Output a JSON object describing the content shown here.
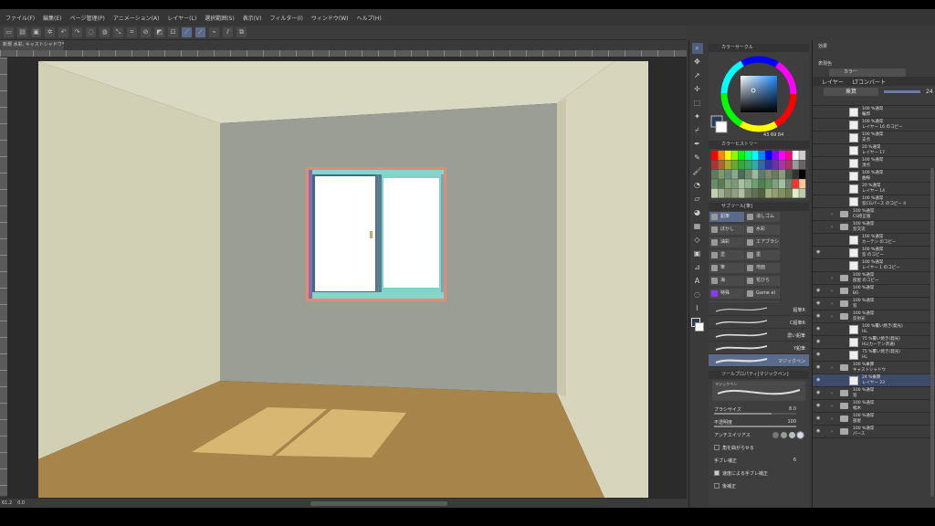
{
  "menu": [
    "ファイル(F)",
    "編集(E)",
    "ページ管理(P)",
    "アニメーション(A)",
    "レイヤー(L)",
    "選択範囲(S)",
    "表示(V)",
    "フィルター(I)",
    "ウィンドウ(W)",
    "ヘルプ(H)"
  ],
  "document_tab": "新規 水彩, キャストシャドウ* ×",
  "status": {
    "zoom": "61.2",
    "angle": "0.0"
  },
  "color_panel": {
    "title": "カラーサークル",
    "values": "43  69  84"
  },
  "swatch_panel": {
    "title": "カラーヒストリー"
  },
  "subtool": {
    "title": "サブツール[筆]",
    "tabs": [
      "鉛筆",
      "消しゴム",
      "ぼかし",
      "水彩",
      "油彩",
      "エアブラシ",
      "塗",
      "墨",
      "筆",
      "地面",
      "海",
      "花びら",
      "特殊",
      "Game el",
      "brushes",
      "ブラシ素材",
      "velvetco",
      "velvetco",
      "Rock&Di"
    ],
    "brushes": [
      {
        "name": "鉛筆R"
      },
      {
        "name": "C鉛筆R"
      },
      {
        "name": "濃い鉛筆"
      },
      {
        "name": "Y鉛筆"
      },
      {
        "name": "マジックペン"
      }
    ]
  },
  "tool_property": {
    "title": "ツールプロパティ[マジックペン]",
    "brush_preview_name": "マジックペン",
    "brush_size_label": "ブラシサイズ",
    "brush_size_value": "8.0",
    "opacity_label": "不透明度",
    "opacity_value": "100",
    "antialias_label": "アンチエイリアス",
    "corner_label": "角を曲がらせる",
    "stabilize_label": "手ブレ補正",
    "stabilize_value": "6",
    "speed_label": "速度による手ブレ補正",
    "post_label": "後補正"
  },
  "layer_panel": {
    "effect_label": "効果",
    "expression_label": "表現色",
    "expression_value": "カラー",
    "tab_layer": "レイヤー",
    "tab_other": "LTコンバート",
    "blend": "乗算",
    "opacity": "24",
    "layers": [
      {
        "mode": "100 %通常",
        "name": "輪郭",
        "type": "layer",
        "eye": false
      },
      {
        "mode": "100 %通常",
        "name": "レイヤー 16 のコピー",
        "type": "layer",
        "eye": false
      },
      {
        "mode": "100 %通常",
        "name": "支点",
        "type": "layer",
        "eye": false
      },
      {
        "mode": "20 %通常",
        "name": "レイヤー 17",
        "type": "layer",
        "eye": false
      },
      {
        "mode": "100 %通常",
        "name": "頂点",
        "type": "layer",
        "eye": false
      },
      {
        "mode": "100 %通常",
        "name": "曲線",
        "type": "layer",
        "eye": false
      },
      {
        "mode": "20 %通常",
        "name": "レイヤー 14",
        "type": "layer",
        "eye": false
      },
      {
        "mode": "100 %通常",
        "name": "窓CGパース のコピー 4",
        "type": "layer",
        "eye": false
      },
      {
        "mode": "100 %通常",
        "name": "CS修正版",
        "type": "folder",
        "eye": false
      },
      {
        "mode": "100 %通常",
        "name": "窓交流",
        "type": "folder",
        "eye": false
      },
      {
        "mode": "100 %通常",
        "name": "カーテン のコピー",
        "type": "layer",
        "eye": false
      },
      {
        "mode": "100 %通常",
        "name": "窓 のコピー",
        "type": "layer",
        "eye": true
      },
      {
        "mode": "100 %通常",
        "name": "レイヤー 1 のコピー",
        "type": "layer",
        "eye": false
      },
      {
        "mode": "100 %通常",
        "name": "部屋 のコピー",
        "type": "folder",
        "eye": false
      },
      {
        "mode": "100 %通常",
        "name": "BG",
        "type": "folder",
        "eye": true
      },
      {
        "mode": "100 %通常",
        "name": "窓",
        "type": "folder",
        "eye": true
      },
      {
        "mode": "100 %通常",
        "name": "反射光",
        "type": "folder",
        "eye": true
      },
      {
        "mode": "100 %覆い焼き(発光)",
        "name": "HL",
        "type": "layer",
        "eye": true
      },
      {
        "mode": "75 %覆い焼き(発光)",
        "name": "HL(カーテン斉通)",
        "type": "layer",
        "eye": true
      },
      {
        "mode": "75 %覆い焼き(発光)",
        "name": "HL",
        "type": "layer",
        "eye": true
      },
      {
        "mode": "100 %乗算",
        "name": "キャストシャドウ",
        "type": "folder",
        "eye": true
      },
      {
        "mode": "24 %乗算",
        "name": "レイヤー 23",
        "type": "layer",
        "eye": true,
        "selected": true
      },
      {
        "mode": "100 %通常",
        "name": "窓",
        "type": "folder",
        "eye": true
      },
      {
        "mode": "100 %通常",
        "name": "幅木",
        "type": "folder",
        "eye": true
      },
      {
        "mode": "100 %通常",
        "name": "部屋",
        "type": "folder",
        "eye": true
      },
      {
        "mode": "100 %通常",
        "name": "パース",
        "type": "folder",
        "eye": true
      }
    ]
  }
}
